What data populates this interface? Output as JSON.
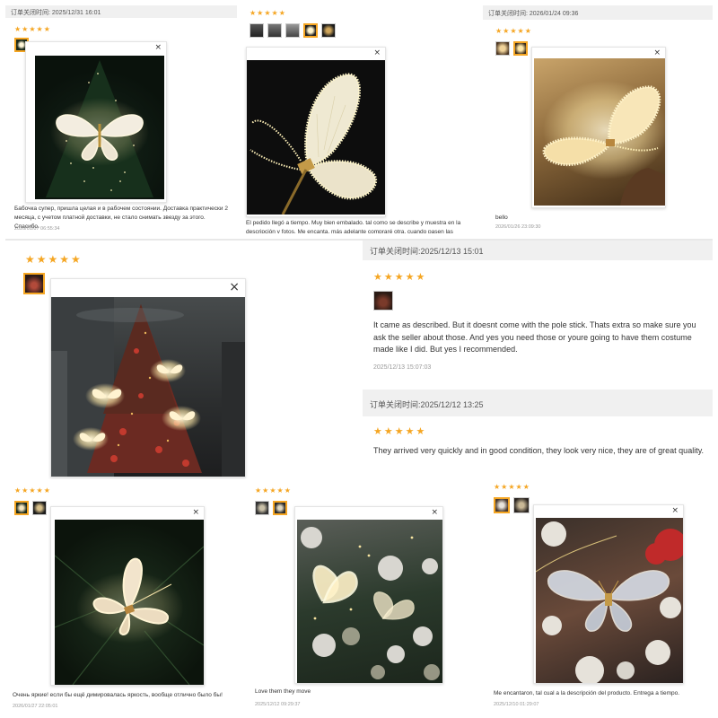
{
  "reviews": [
    {
      "header": "订单关闭时间: 2025/12/31 16:01",
      "stars": "★★★★★",
      "text": "Бабочка супер, пришла целая и в рабочем состоянии. Доставка практически 2 месяца, с учетом платной доставки, не стало снимать звезду за этого. Спасибо.",
      "date": "2026/01/07 06:55:34",
      "close": "×"
    },
    {
      "stars": "★★★★★",
      "text": "El pedido llegó a tiempo. Muy bien embalado. tal como se describe y muestra en la descripción y fotos. Me encanta, más adelante compraré otra, cuando pasen las",
      "close": "×"
    },
    {
      "header": "订单关闭时间: 2026/01/24 09:36",
      "stars": "★★★★★",
      "text": "bello",
      "date": "2026/01/26 23:09:30",
      "close": "×"
    },
    {
      "stars": "★★★★★",
      "close": "×"
    },
    {
      "header": "订单关闭时间:2025/12/13 15:01",
      "stars": "★★★★★",
      "text": "It came as described. But it doesnt come with the pole stick. Thats extra so make sure you ask the seller about those. And yes you need those or youre going to have them costume made like I did. But yes I recommended.",
      "date": "2025/12/13 15:07:03"
    },
    {
      "header": "订单关闭时间:2025/12/12 13:25",
      "stars": "★★★★★",
      "text": "They arrived very quickly and in good condition, they look very nice, they are of great quality."
    },
    {
      "stars": "★★★★★",
      "text": "Очень яркие! если бы ещё димировалась яркость, вообще отлично было бы!",
      "date": "2026/01/27 22:05:01",
      "close": "×"
    },
    {
      "stars": "★★★★★",
      "text": "Love them they move",
      "date": "2025/12/12 09:29:37",
      "close": "×"
    },
    {
      "stars": "★★★★★",
      "text": "Me encantaron, tal cual a la descripción del producto. Entrega a tiempo.",
      "date": "2025/12/10 01:29:07",
      "close": "×"
    }
  ],
  "colors": {
    "star": "#f5a623",
    "header_bg": "#f0f0f0",
    "date": "#999999"
  }
}
